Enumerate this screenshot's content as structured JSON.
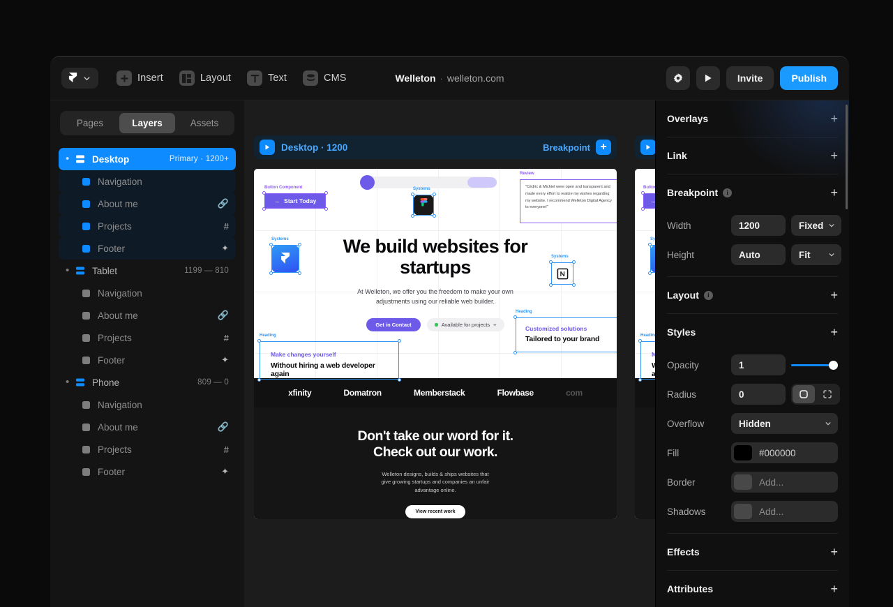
{
  "topbar": {
    "logo_icon": "framer-logo-icon",
    "chevron_icon": "chevron-down-icon",
    "tools": [
      {
        "label": "Insert",
        "icon": "plus-square-icon"
      },
      {
        "label": "Layout",
        "icon": "layout-grid-icon"
      },
      {
        "label": "Text",
        "icon": "text-t-icon"
      },
      {
        "label": "CMS",
        "icon": "database-icon"
      }
    ],
    "site_name": "Welleton",
    "separator": "·",
    "site_domain": "welleton.com",
    "settings_icon": "gear-icon",
    "preview_icon": "play-icon",
    "invite_label": "Invite",
    "publish_label": "Publish",
    "accent": "#1a9afe"
  },
  "left_panel": {
    "tabs": [
      {
        "label": "Pages",
        "active": false
      },
      {
        "label": "Layers",
        "active": true
      },
      {
        "label": "Assets",
        "active": false
      }
    ],
    "layers": [
      {
        "name": "Desktop",
        "meta": "Primary · 1200+",
        "type": "group",
        "selected": true
      },
      {
        "name": "Navigation",
        "badge": "",
        "type": "child",
        "selected": true
      },
      {
        "name": "About me",
        "badge": "link-icon",
        "type": "child",
        "selected": true
      },
      {
        "name": "Projects",
        "badge": "hash-icon",
        "type": "child",
        "selected": true
      },
      {
        "name": "Footer",
        "badge": "sparkle-icon",
        "type": "child",
        "selected": true
      },
      {
        "name": "Tablet",
        "meta": "1199 — 810",
        "type": "group",
        "selected": false
      },
      {
        "name": "Navigation",
        "badge": "",
        "type": "child",
        "selected": false
      },
      {
        "name": "About me",
        "badge": "link-icon",
        "type": "child",
        "selected": false
      },
      {
        "name": "Projects",
        "badge": "hash-icon",
        "type": "child",
        "selected": false
      },
      {
        "name": "Footer",
        "badge": "sparkle-icon",
        "type": "child",
        "selected": false
      },
      {
        "name": "Phone",
        "meta": "809 — 0",
        "type": "group",
        "selected": false
      },
      {
        "name": "Navigation",
        "badge": "",
        "type": "child",
        "selected": false
      },
      {
        "name": "About me",
        "badge": "link-icon",
        "type": "child",
        "selected": false
      },
      {
        "name": "Projects",
        "badge": "hash-icon",
        "type": "child",
        "selected": false
      },
      {
        "name": "Footer",
        "badge": "sparkle-icon",
        "type": "child",
        "selected": false
      }
    ]
  },
  "canvas": {
    "frame1": {
      "label": "Desktop · 1200",
      "breakpoint_label": "Breakpoint",
      "plus": "+",
      "play_icon": "play-icon"
    },
    "frame2": {
      "play_icon": "play-icon"
    },
    "site": {
      "heading": "We build websites for startups",
      "subtext": "At Welleton, we offer you the freedom to make your own adjustments using our reliable web builder.",
      "cta_primary": "Get in Contact",
      "cta_secondary": "Available for projects",
      "cta_secondary_plus": "+",
      "start_button": "Start Today",
      "start_button_arrow": "→",
      "tag_button_component": "Button Component",
      "tag_systems": "Systems",
      "tag_review": "Review",
      "tag_heading": "Heading",
      "quote": "\"Cédric & Michiel were open and transparent and made every effort to realize my wishes regarding my website. I recommend Welleton Digital Agency to everyone!\"",
      "left_block_eyebrow": "Make changes yourself",
      "left_block_title": "Without hiring a web developer again",
      "right_block_eyebrow": "Customized solutions",
      "right_block_title": "Tailored to your brand",
      "logos": [
        "xfinity",
        "Domatron",
        "Memberstack",
        "Flowbase",
        "com"
      ],
      "dark_heading_line1": "Don't take our word for it.",
      "dark_heading_line2": "Check out our work.",
      "dark_paragraph": "Welleton designs, builds & ships websites that give growing startups and companies an unfair advantage online.",
      "dark_button": "View recent work",
      "icon_figma": "figma-icon",
      "icon_framer": "framer-icon",
      "icon_notion": "notion-icon"
    }
  },
  "right_panel": {
    "sections": {
      "overlays": {
        "title": "Overlays",
        "plus": "+"
      },
      "link": {
        "title": "Link",
        "plus": "+"
      },
      "breakpoint": {
        "title": "Breakpoint",
        "plus": "+",
        "info_icon": "info-icon"
      },
      "layout": {
        "title": "Layout",
        "plus": "+",
        "info_icon": "info-icon"
      },
      "styles": {
        "title": "Styles",
        "plus": "+"
      },
      "effects": {
        "title": "Effects",
        "plus": "+"
      },
      "attributes": {
        "title": "Attributes",
        "plus": "+"
      }
    },
    "breakpoint_props": [
      {
        "label": "Width",
        "value": "1200",
        "mode": "Fixed"
      },
      {
        "label": "Height",
        "value": "Auto",
        "mode": "Fit"
      }
    ],
    "styles_props": {
      "opacity_label": "Opacity",
      "opacity_value": "1",
      "radius_label": "Radius",
      "radius_value": "0",
      "radius_mode_all_icon": "radius-all-icon",
      "radius_mode_individual_icon": "radius-individual-icon",
      "overflow_label": "Overflow",
      "overflow_value": "Hidden",
      "fill_label": "Fill",
      "fill_value": "#000000",
      "fill_color": "#000000",
      "border_label": "Border",
      "border_value": "Add...",
      "shadows_label": "Shadows",
      "shadows_value": "Add..."
    },
    "chevron_icon": "chevron-down-icon",
    "slider_accent": "#0d8bff"
  }
}
